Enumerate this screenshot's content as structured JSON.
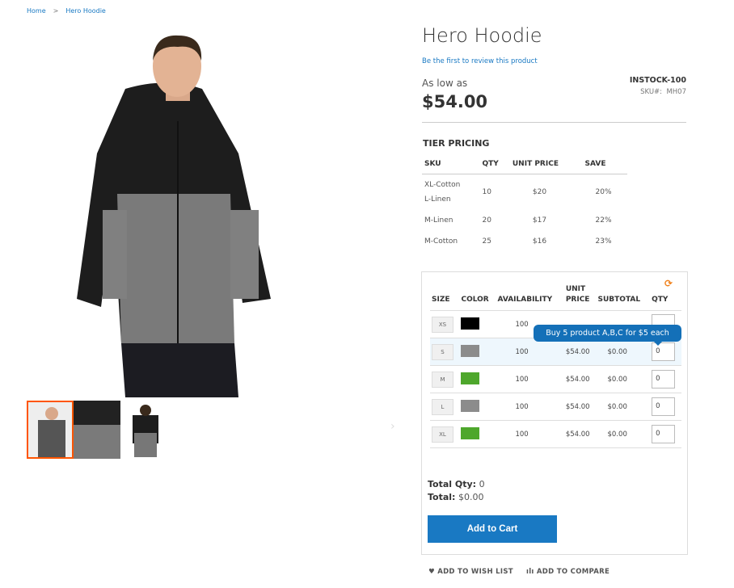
{
  "breadcrumb": {
    "home": "Home",
    "separator": ">",
    "current": "Hero Hoodie"
  },
  "product": {
    "title": "Hero Hoodie",
    "review_link": "Be the first to review this product",
    "as_low_as": "As low as",
    "price": "$54.00",
    "stock": "INSTOCK-100",
    "sku_label": "SKU#:",
    "sku": "MH07"
  },
  "tier": {
    "heading": "TIER PRICING",
    "columns": [
      "SKU",
      "QTY",
      "UNIT PRICE",
      "SAVE"
    ],
    "rows": [
      {
        "sku1": "XL-Cotton",
        "sku2": "L-Linen",
        "qty": "10",
        "price": "$20",
        "save": "20%"
      },
      {
        "sku1": "M-Linen",
        "qty": "20",
        "price": "$17",
        "save": "22%"
      },
      {
        "sku1": "M-Cotton",
        "qty": "25",
        "price": "$16",
        "save": "23%"
      }
    ]
  },
  "grid": {
    "columns": {
      "size": "SIZE",
      "color": "COLOR",
      "availability": "AVAILABILITY",
      "unit1": "UNIT",
      "unit2": "PRICE",
      "subtotal": "SUBTOTAL",
      "qty": "QTY"
    },
    "rows": [
      {
        "size": "XS",
        "color": "#000000",
        "availability": "100",
        "price": "",
        "subtotal": "",
        "qty": ""
      },
      {
        "size": "S",
        "color": "#8c8c8c",
        "availability": "100",
        "price": "$54.00",
        "subtotal": "$0.00",
        "qty": "0"
      },
      {
        "size": "M",
        "color": "#4ea72c",
        "availability": "100",
        "price": "$54.00",
        "subtotal": "$0.00",
        "qty": "0"
      },
      {
        "size": "L",
        "color": "#8c8c8c",
        "availability": "100",
        "price": "$54.00",
        "subtotal": "$0.00",
        "qty": "0"
      },
      {
        "size": "XL",
        "color": "#4ea72c",
        "availability": "100",
        "price": "$54.00",
        "subtotal": "$0.00",
        "qty": "0"
      }
    ],
    "tooltip": "Buy 5 product A,B,C for $5 each"
  },
  "totals": {
    "qty_label": "Total Qty:",
    "qty": "0",
    "total_label": "Total:",
    "total": "$0.00"
  },
  "actions": {
    "add_to_cart": "Add to Cart",
    "wishlist": "ADD TO WISH LIST",
    "compare": "ADD TO COMPARE"
  },
  "colors": {
    "accent": "#1979c3",
    "refresh": "#f0811c",
    "thumb_selected": "#ff5501"
  }
}
